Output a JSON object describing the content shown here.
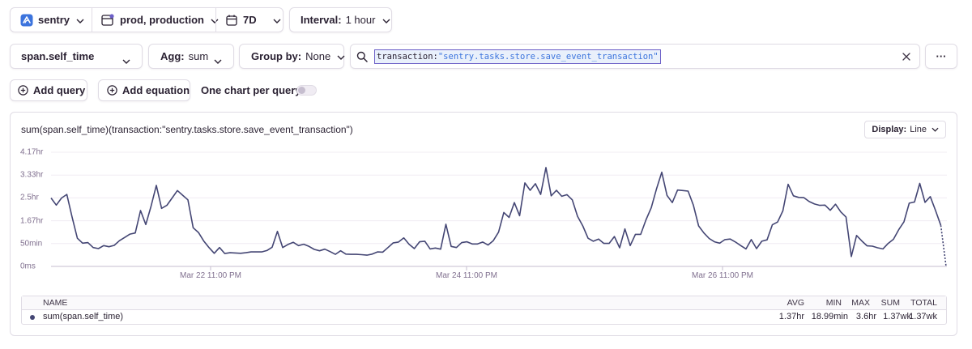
{
  "header": {
    "project": "sentry",
    "environment": "prod, production",
    "period": "7D",
    "interval_label": "Interval:",
    "interval_value": "1 hour"
  },
  "query_bar": {
    "field": "span.self_time",
    "agg_label": "Agg:",
    "agg_value": "sum",
    "group_label": "Group by:",
    "group_value": "None",
    "search_key": "transaction:",
    "search_value": "\"sentry.tasks.store.save_event_transaction\"",
    "more": "···"
  },
  "actions": {
    "add_query": "Add query",
    "add_equation": "Add equation",
    "one_chart_label": "One chart per query",
    "one_chart_on": false
  },
  "chart": {
    "title": "sum(span.self_time)(transaction:\"sentry.tasks.store.save_event_transaction\")",
    "display_label": "Display:",
    "display_value": "Line",
    "y_ticks": [
      "4.17hr",
      "3.33hr",
      "2.5hr",
      "1.67hr",
      "50min",
      "0ms"
    ],
    "x_ticks": [
      "Mar 22 11:00 PM",
      "Mar 24 11:00 PM",
      "Mar 26 11:00 PM"
    ],
    "line_color": "#444674"
  },
  "chart_data": {
    "type": "line",
    "ylabel": "",
    "ylim": [
      0,
      4.17
    ],
    "yunit": "hr",
    "series": [
      {
        "name": "sum(span.self_time)",
        "values": [
          2.5,
          2.24,
          2.5,
          2.63,
          1.8,
          1.03,
          0.85,
          0.87,
          0.69,
          0.65,
          0.76,
          0.72,
          0.77,
          0.94,
          1.06,
          1.18,
          1.22,
          2.04,
          1.53,
          2.2,
          2.96,
          2.12,
          2.23,
          2.5,
          2.77,
          2.6,
          2.43,
          1.41,
          1.24,
          0.93,
          0.69,
          0.48,
          0.69,
          0.47,
          0.5,
          0.49,
          0.48,
          0.5,
          0.53,
          0.53,
          0.53,
          0.58,
          0.7,
          1.28,
          0.69,
          0.8,
          0.88,
          0.76,
          0.81,
          0.73,
          0.62,
          0.57,
          0.63,
          0.54,
          0.44,
          0.57,
          0.45,
          0.44,
          0.44,
          0.43,
          0.41,
          0.45,
          0.53,
          0.52,
          0.69,
          0.86,
          0.89,
          1.04,
          0.81,
          0.65,
          0.9,
          0.92,
          0.64,
          0.67,
          0.63,
          1.54,
          0.73,
          0.69,
          0.87,
          0.9,
          0.82,
          0.82,
          0.89,
          0.78,
          0.94,
          1.25,
          1.97,
          1.79,
          2.33,
          1.85,
          3.05,
          2.78,
          3.02,
          2.63,
          3.61,
          2.58,
          2.78,
          2.56,
          2.62,
          2.43,
          1.83,
          1.48,
          1.03,
          0.92,
          1.0,
          0.84,
          0.84,
          1.09,
          0.68,
          1.37,
          0.76,
          1.17,
          1.17,
          1.7,
          2.14,
          2.83,
          3.44,
          2.59,
          2.33,
          2.79,
          2.77,
          2.75,
          2.24,
          1.48,
          1.22,
          1.02,
          0.9,
          0.85,
          0.98,
          1.0,
          0.89,
          0.76,
          0.64,
          0.98,
          0.65,
          0.92,
          0.97,
          1.52,
          1.62,
          2.03,
          3.0,
          2.58,
          2.52,
          2.51,
          2.37,
          2.28,
          2.23,
          2.24,
          2.05,
          2.27,
          1.99,
          1.8,
          0.36,
          1.13,
          0.93,
          0.75,
          0.74,
          0.68,
          0.64,
          0.84,
          0.99,
          1.34,
          1.63,
          2.31,
          2.35,
          3.03,
          2.34,
          2.55,
          2.04,
          1.5,
          0.0
        ],
        "avg": "1.37hr",
        "min": "18.99min",
        "max": "3.6hr",
        "sum": "1.37wk",
        "total": "1.37wk"
      }
    ],
    "x_tick_labels": [
      "Mar 22 11:00 PM",
      "Mar 24 11:00 PM",
      "Mar 26 11:00 PM"
    ]
  },
  "legend": {
    "headers": {
      "name": "NAME",
      "avg": "AVG",
      "min": "MIN",
      "max": "MAX",
      "sum": "SUM",
      "total": "TOTAL"
    }
  }
}
